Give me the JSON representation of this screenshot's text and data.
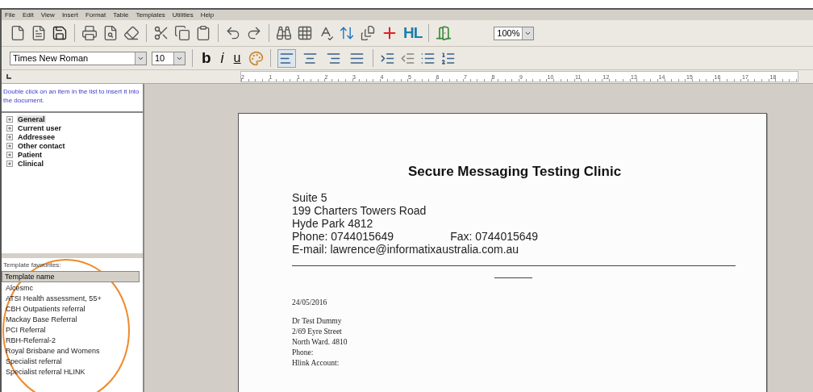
{
  "menu": [
    "File",
    "Edit",
    "View",
    "Insert",
    "Format",
    "Table",
    "Templates",
    "Utilities",
    "Help"
  ],
  "toolbar": {
    "hl_label": "HL",
    "zoom": "100%"
  },
  "format_bar": {
    "font": "Times New Roman",
    "size": "10",
    "bold": "b",
    "italic": "i",
    "underline": "u",
    "alignments": [
      {
        "kind": "left",
        "selected": true
      },
      {
        "kind": "center",
        "selected": false
      },
      {
        "kind": "right",
        "selected": false
      },
      {
        "kind": "justify",
        "selected": false
      }
    ]
  },
  "ruler": [
    "2",
    "1",
    "1",
    "2",
    "3",
    "4",
    "5",
    "6",
    "7",
    "8",
    "9",
    "10",
    "11",
    "12",
    "13",
    "14",
    "15",
    "16",
    "17",
    "18"
  ],
  "sidebar": {
    "hint": "Double click on an item in the list to insert it into the document.",
    "tree": [
      {
        "label": "General",
        "expanded": false,
        "selected": true
      },
      {
        "label": "Current user",
        "expanded": false,
        "selected": false
      },
      {
        "label": "Addressee",
        "expanded": false,
        "selected": false
      },
      {
        "label": "Other contact",
        "expanded": false,
        "selected": false
      },
      {
        "label": "Patient",
        "expanded": false,
        "selected": false
      },
      {
        "label": "Clinical",
        "expanded": false,
        "selected": false
      }
    ],
    "favourites_label": "Template favourites:",
    "favourites_column": "Template name",
    "favourites": [
      "Alcesmc",
      "ATSI Health assessment, 55+",
      "CBH Outpatients referral",
      "Mackay Base Referral",
      "PCI Referral",
      "RBH-Referral-2",
      "Royal Brisbane and Womens",
      "Specialist referral",
      "Specialist referral HLINK"
    ]
  },
  "document": {
    "title": "Secure Messaging Testing Clinic",
    "address": [
      "Suite 5",
      "199 Charters Towers Road",
      "Hyde Park  4812"
    ],
    "phone": "Phone: 0744015649",
    "fax": "Fax: 0744015649",
    "email": "E-mail: lawrence@informatixaustralia.com.au",
    "date": "24/05/2016",
    "recipient": [
      "Dr Test Dummy",
      "2/69 Eyre Street",
      "North Ward.  4810",
      "Phone:",
      "Hlink Account:"
    ]
  }
}
